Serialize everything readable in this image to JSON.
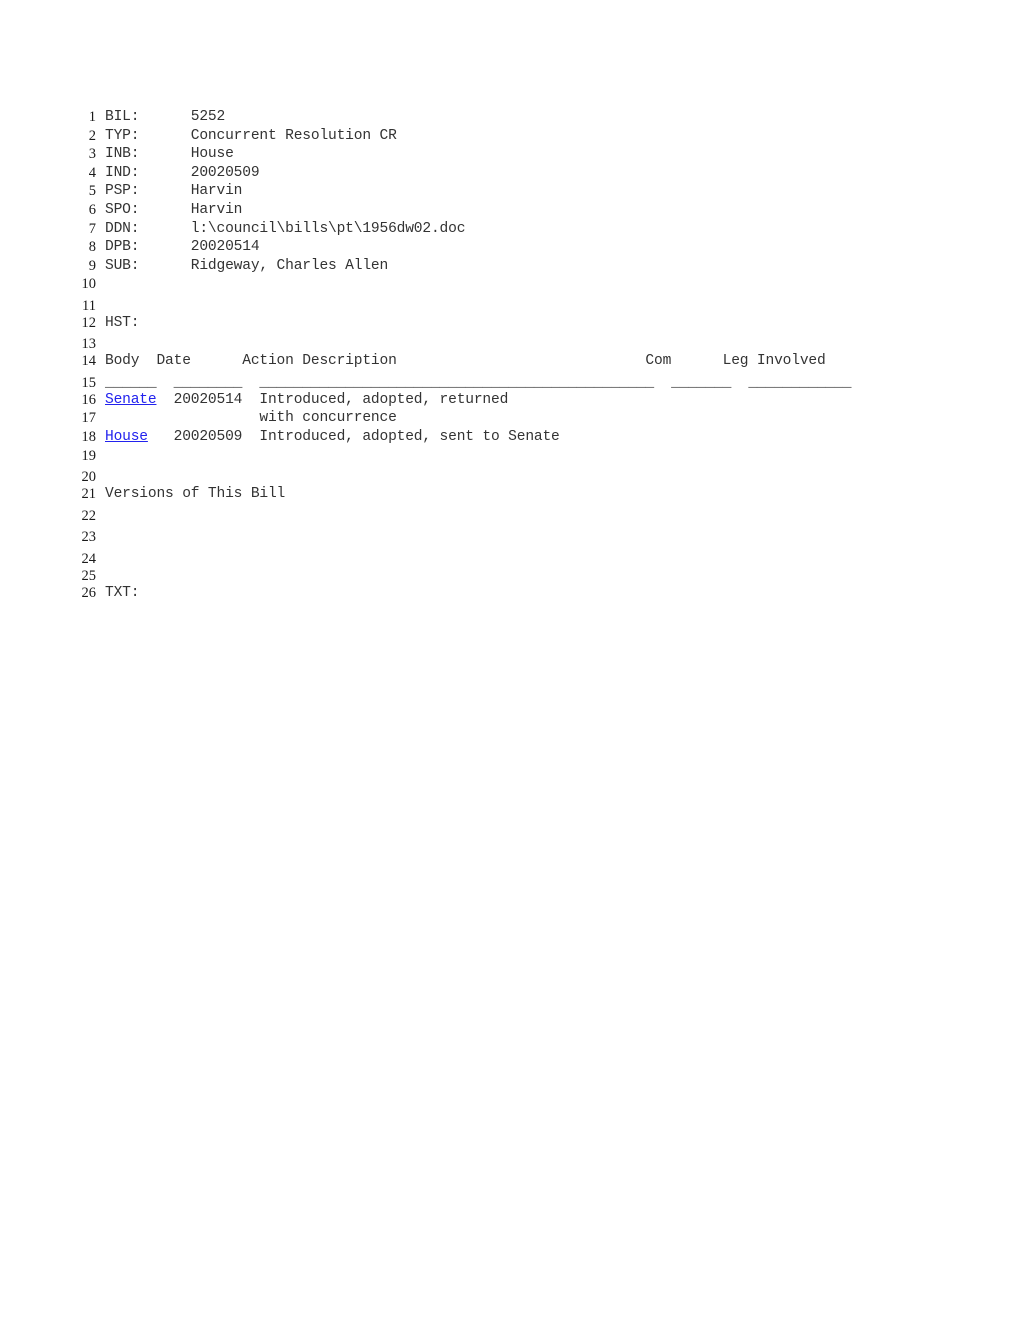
{
  "document": {
    "type": "legislative-bill-record",
    "fields": [
      {
        "line": 1,
        "key": "BIL:",
        "value": "5252"
      },
      {
        "line": 2,
        "key": "TYP:",
        "value": "Concurrent Resolution CR"
      },
      {
        "line": 3,
        "key": "INB:",
        "value": "House"
      },
      {
        "line": 4,
        "key": "IND:",
        "value": "20020509"
      },
      {
        "line": 5,
        "key": "PSP:",
        "value": "Harvin"
      },
      {
        "line": 6,
        "key": "SPO:",
        "value": "Harvin"
      },
      {
        "line": 7,
        "key": "DDN:",
        "value": "l:\\council\\bills\\pt\\1956dw02.doc"
      },
      {
        "line": 8,
        "key": "DPB:",
        "value": "20020514"
      },
      {
        "line": 9,
        "key": "SUB:",
        "value": "Ridgeway, Charles Allen"
      }
    ],
    "history_label": "HST:",
    "history_table": {
      "headers": {
        "body": "Body",
        "date": "Date",
        "action": "Action Description",
        "com": "Com",
        "leg": "Leg Involved"
      },
      "rules": {
        "body": "______",
        "date": "________",
        "action": "______________________________________________",
        "com": "_______",
        "leg": "____________"
      },
      "rows": [
        {
          "body": "Senate",
          "body_is_link": true,
          "date": "20020514",
          "action": "Introduced, adopted, returned",
          "action_continued": "with concurrence",
          "com": "",
          "leg": ""
        },
        {
          "body": "House",
          "body_is_link": true,
          "date": "20020509",
          "action": "Introduced, adopted, sent to Senate",
          "action_continued": "",
          "com": "",
          "leg": ""
        }
      ]
    },
    "versions_label": "Versions of This Bill",
    "txt_label": "TXT:",
    "line_numbers": [
      1,
      2,
      3,
      4,
      5,
      6,
      7,
      8,
      9,
      10,
      11,
      12,
      13,
      14,
      15,
      16,
      17,
      18,
      19,
      20,
      21,
      22,
      23,
      24,
      25,
      26
    ],
    "colors": {
      "text": "#333333",
      "line_number": "#1a1a1a",
      "link": "#2222ee",
      "background": "#ffffff"
    }
  }
}
